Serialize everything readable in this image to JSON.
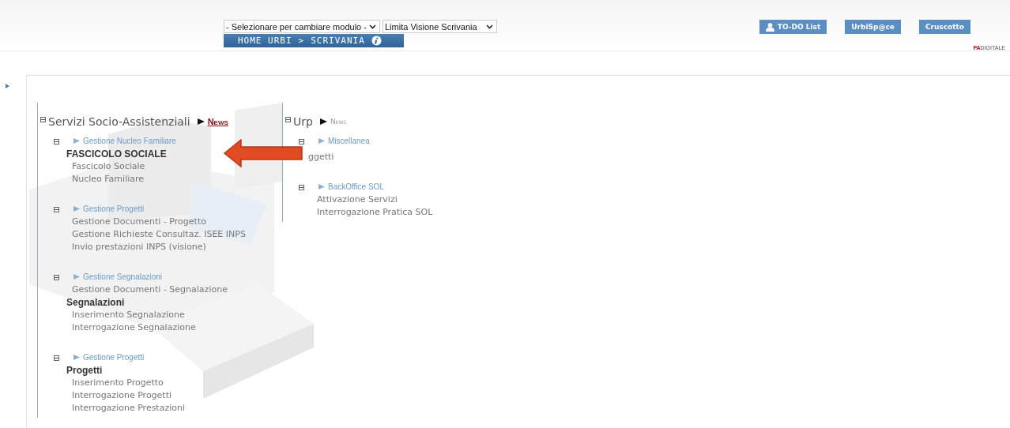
{
  "header": {
    "module_select": "- Selezionare per cambiare modulo -",
    "view_select": "Limita Visione Scrivania",
    "breadcrumb": [
      "HOME URBI",
      "SCRIVANIA"
    ],
    "breadcrumb_separator": ">",
    "buttons": [
      {
        "label": "TO-DO List",
        "kind": "user"
      },
      {
        "label": "UrbiSp@ce",
        "kind": "plain"
      },
      {
        "label": "Cruscotto",
        "kind": "plain"
      }
    ],
    "brand": {
      "prefix": "PA",
      "rest": "DIGITALE"
    }
  },
  "sections": [
    {
      "title": "Servizi Socio-Assistenziali",
      "news": "News",
      "kind": "highlight",
      "expanded": true,
      "groups": [
        {
          "title": "Gestione Nucleo Familiare",
          "expanded": true,
          "items": [
            {
              "kind": "heading",
              "text": "FASCICOLO SOCIALE"
            },
            {
              "kind": "link",
              "text": "Fascicolo Sociale"
            },
            {
              "kind": "link",
              "text": "Nucleo Familiare"
            }
          ]
        },
        {
          "title": "Gestione Progetti",
          "expanded": true,
          "items": [
            {
              "kind": "link",
              "text": "Gestione Documenti - Progetto"
            },
            {
              "kind": "link",
              "text": "Gestione Richieste Consultaz. ISEE INPS"
            },
            {
              "kind": "link",
              "text": "Invio prestazioni INPS (visione)"
            }
          ]
        },
        {
          "title": "Gestione Segnalazioni",
          "expanded": true,
          "items": [
            {
              "kind": "link",
              "text": "Gestione Documenti - Segnalazione"
            },
            {
              "kind": "heading",
              "text": "Segnalazioni"
            },
            {
              "kind": "link",
              "text": "Inserimento Segnalazione"
            },
            {
              "kind": "link",
              "text": "Interrogazione Segnalazione"
            }
          ]
        },
        {
          "title": "Gestione Progetti",
          "expanded": true,
          "items": [
            {
              "kind": "heading",
              "text": "Progetti"
            },
            {
              "kind": "link",
              "text": "Inserimento Progetto"
            },
            {
              "kind": "link",
              "text": "Interrogazione Progetti"
            },
            {
              "kind": "link",
              "text": "Interrogazione Prestazioni"
            }
          ]
        }
      ]
    },
    {
      "title": "Urp",
      "news": "News",
      "kind": "plain",
      "expanded": true,
      "groups": [
        {
          "title": "Miscellanea",
          "expanded": true,
          "items": [
            {
              "kind": "covered",
              "text": "ggetti"
            }
          ]
        },
        {
          "title": "BackOffice SOL",
          "expanded": true,
          "items": [
            {
              "kind": "link",
              "text": "Attivazione Servizi"
            },
            {
              "kind": "link",
              "text": "Interrogazione Pratica SOL"
            }
          ]
        }
      ]
    }
  ],
  "annotations": [
    {
      "kind": "arrow"
    }
  ]
}
